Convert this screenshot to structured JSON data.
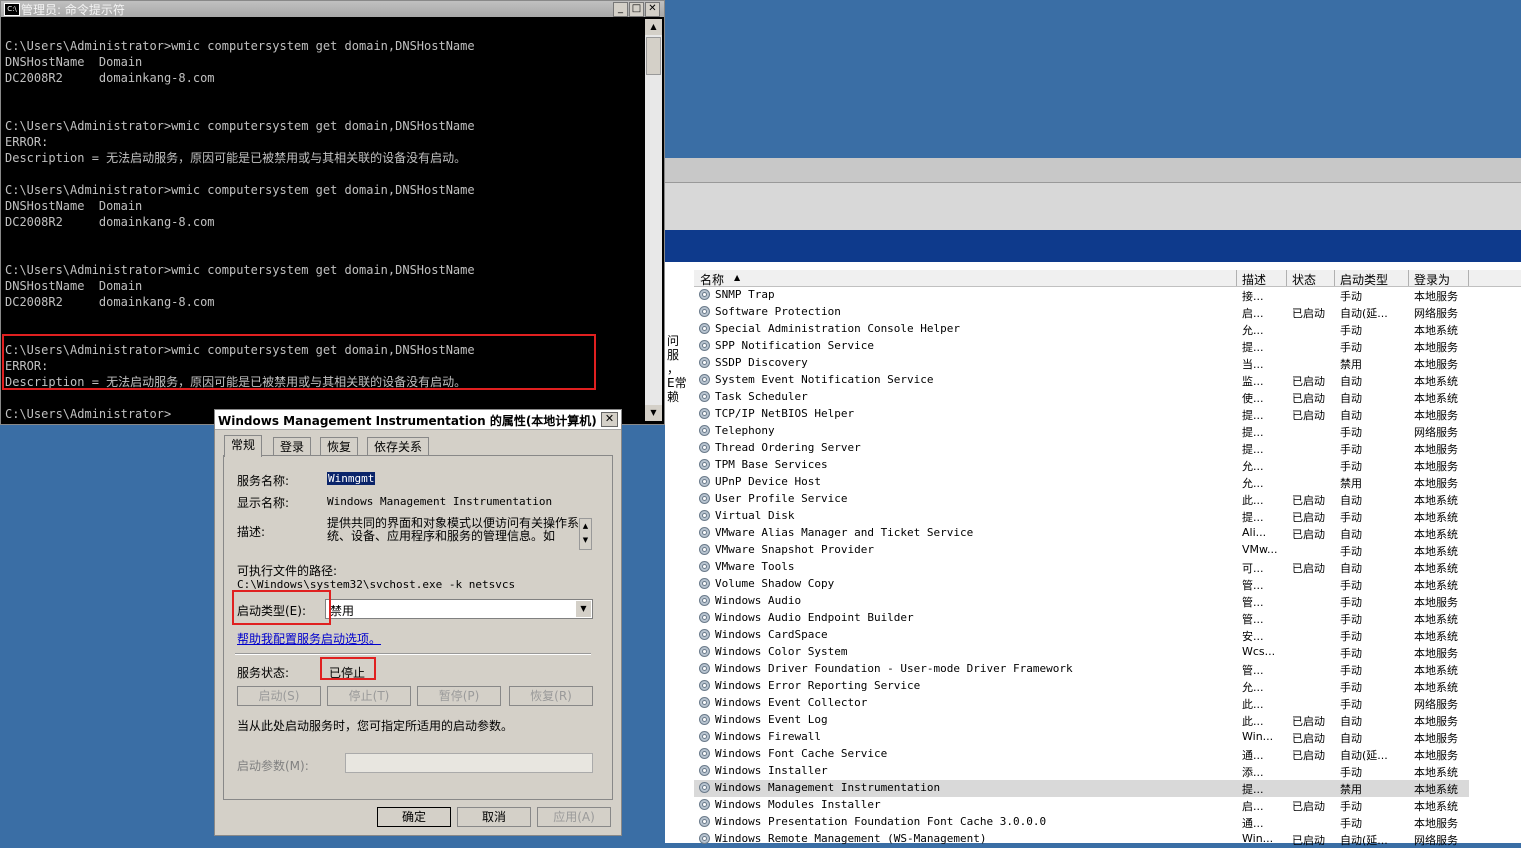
{
  "console": {
    "title": "管理员: 命令提示符",
    "lines": [
      "C:\\Users\\Administrator>wmic computersystem get domain,DNSHostName",
      "DNSHostName  Domain",
      "DC2008R2     domainkang-8.com",
      "",
      "",
      "C:\\Users\\Administrator>wmic computersystem get domain,DNSHostName",
      "ERROR:",
      "Description = 无法启动服务，原因可能是已被禁用或与其相关联的设备没有启动。",
      "",
      "C:\\Users\\Administrator>wmic computersystem get domain,DNSHostName",
      "DNSHostName  Domain",
      "DC2008R2     domainkang-8.com",
      "",
      "",
      "C:\\Users\\Administrator>wmic computersystem get domain,DNSHostName",
      "DNSHostName  Domain",
      "DC2008R2     domainkang-8.com",
      "",
      "",
      "C:\\Users\\Administrator>wmic computersystem get domain,DNSHostName",
      "ERROR:",
      "Description = 无法启动服务，原因可能是已被禁用或与其相关联的设备没有启动。",
      "",
      "C:\\Users\\Administrator>"
    ]
  },
  "side_text": [
    "问",
    "服",
    "，",
    "E常",
    "赖"
  ],
  "services": {
    "headers": [
      "名称",
      "描述",
      "状态",
      "启动类型",
      "登录为"
    ],
    "rows": [
      [
        "SNMP Trap",
        "接...",
        "",
        "手动",
        "本地服务"
      ],
      [
        "Software Protection",
        "启...",
        "已启动",
        "自动(延...",
        "网络服务"
      ],
      [
        "Special Administration Console Helper",
        "允...",
        "",
        "手动",
        "本地系统"
      ],
      [
        "SPP Notification Service",
        "提...",
        "",
        "手动",
        "本地服务"
      ],
      [
        "SSDP Discovery",
        "当...",
        "",
        "禁用",
        "本地服务"
      ],
      [
        "System Event Notification Service",
        "监...",
        "已启动",
        "自动",
        "本地系统"
      ],
      [
        "Task Scheduler",
        "使...",
        "已启动",
        "自动",
        "本地系统"
      ],
      [
        "TCP/IP NetBIOS Helper",
        "提...",
        "已启动",
        "自动",
        "本地服务"
      ],
      [
        "Telephony",
        "提...",
        "",
        "手动",
        "网络服务"
      ],
      [
        "Thread Ordering Server",
        "提...",
        "",
        "手动",
        "本地服务"
      ],
      [
        "TPM Base Services",
        "允...",
        "",
        "手动",
        "本地服务"
      ],
      [
        "UPnP Device Host",
        "允...",
        "",
        "禁用",
        "本地服务"
      ],
      [
        "User Profile Service",
        "此...",
        "已启动",
        "自动",
        "本地系统"
      ],
      [
        "Virtual Disk",
        "提...",
        "已启动",
        "手动",
        "本地系统"
      ],
      [
        "VMware Alias Manager and Ticket Service",
        "Ali...",
        "已启动",
        "自动",
        "本地系统"
      ],
      [
        "VMware Snapshot Provider",
        "VMw...",
        "",
        "手动",
        "本地系统"
      ],
      [
        "VMware Tools",
        "可...",
        "已启动",
        "自动",
        "本地系统"
      ],
      [
        "Volume Shadow Copy",
        "管...",
        "",
        "手动",
        "本地系统"
      ],
      [
        "Windows Audio",
        "管...",
        "",
        "手动",
        "本地服务"
      ],
      [
        "Windows Audio Endpoint Builder",
        "管...",
        "",
        "手动",
        "本地系统"
      ],
      [
        "Windows CardSpace",
        "安...",
        "",
        "手动",
        "本地系统"
      ],
      [
        "Windows Color System",
        "Wcs...",
        "",
        "手动",
        "本地服务"
      ],
      [
        "Windows Driver Foundation - User-mode Driver Framework",
        "管...",
        "",
        "手动",
        "本地系统"
      ],
      [
        "Windows Error Reporting Service",
        "允...",
        "",
        "手动",
        "本地系统"
      ],
      [
        "Windows Event Collector",
        "此...",
        "",
        "手动",
        "网络服务"
      ],
      [
        "Windows Event Log",
        "此...",
        "已启动",
        "自动",
        "本地服务"
      ],
      [
        "Windows Firewall",
        "Win...",
        "已启动",
        "自动",
        "本地服务"
      ],
      [
        "Windows Font Cache Service",
        "通...",
        "已启动",
        "自动(延...",
        "本地服务"
      ],
      [
        "Windows Installer",
        "添...",
        "",
        "手动",
        "本地系统"
      ],
      [
        "Windows Management Instrumentation",
        "提...",
        "",
        "禁用",
        "本地系统"
      ],
      [
        "Windows Modules Installer",
        "启...",
        "已启动",
        "手动",
        "本地系统"
      ],
      [
        "Windows Presentation Foundation Font Cache 3.0.0.0",
        "通...",
        "",
        "手动",
        "本地服务"
      ],
      [
        "Windows Remote Management (WS-Management)",
        "Win...",
        "已启动",
        "自动(延...",
        "网络服务"
      ]
    ],
    "selected_index": 29
  },
  "dialog": {
    "title": "Windows Management Instrumentation 的属性(本地计算机)",
    "tabs": [
      "常规",
      "登录",
      "恢复",
      "依存关系"
    ],
    "service_name_label": "服务名称:",
    "service_name": "Winmgmt",
    "display_name_label": "显示名称:",
    "display_name": "Windows Management Instrumentation",
    "description_label": "描述:",
    "description": "提供共同的界面和对象模式以便访问有关操作系统、设备、应用程序和服务的管理信息。如",
    "path_label": "可执行文件的路径:",
    "path": "C:\\Windows\\system32\\svchost.exe -k netsvcs",
    "startup_type_label": "启动类型(E):",
    "startup_type": "禁用",
    "help_link": "帮助我配置服务启动选项。",
    "status_label": "服务状态:",
    "status": "已停止",
    "start_btn": "启动(S)",
    "stop_btn": "停止(T)",
    "pause_btn": "暂停(P)",
    "resume_btn": "恢复(R)",
    "hint": "当从此处启动服务时，您可指定所适用的启动参数。",
    "params_label": "启动参数(M):",
    "ok_btn": "确定",
    "cancel_btn": "取消",
    "apply_btn": "应用(A)"
  },
  "colors": {
    "desktop": "#3a6ea5",
    "highlight_box": "#e02020",
    "link": "#0000cc"
  }
}
